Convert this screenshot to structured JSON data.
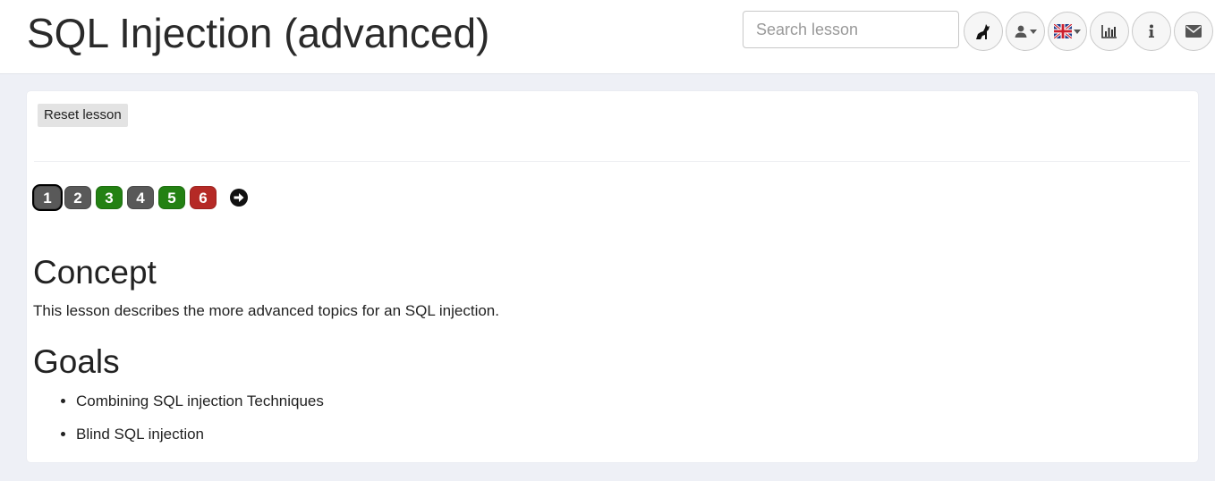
{
  "header": {
    "title": "SQL Injection (advanced)",
    "search_placeholder": "Search lesson",
    "buttons": [
      {
        "name": "webgoat-logo",
        "icon": "wolf-icon"
      },
      {
        "name": "user-menu",
        "icon": "user-icon"
      },
      {
        "name": "language-menu",
        "icon": "uk-flag-icon"
      },
      {
        "name": "report-card",
        "icon": "bar-chart-icon"
      },
      {
        "name": "about",
        "icon": "info-icon"
      },
      {
        "name": "contact",
        "icon": "envelope-icon"
      }
    ]
  },
  "lesson": {
    "reset_label": "Reset lesson",
    "steps": [
      {
        "label": "1",
        "status": "active",
        "color": "#595959"
      },
      {
        "label": "2",
        "status": "unsolved",
        "color": "#595959"
      },
      {
        "label": "3",
        "status": "solved",
        "color": "#238113"
      },
      {
        "label": "4",
        "status": "unsolved",
        "color": "#595959"
      },
      {
        "label": "5",
        "status": "solved",
        "color": "#238113"
      },
      {
        "label": "6",
        "status": "failed",
        "color": "#b52a26"
      }
    ],
    "concept_heading": "Concept",
    "concept_text": "This lesson describes the more advanced topics for an SQL injection.",
    "goals_heading": "Goals",
    "goals": [
      "Combining SQL injection Techniques",
      "Blind SQL injection"
    ]
  }
}
